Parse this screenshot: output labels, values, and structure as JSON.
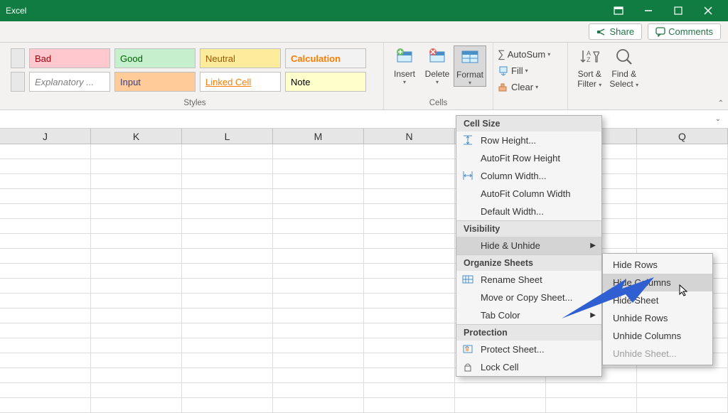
{
  "app": {
    "title": "Excel"
  },
  "actions": {
    "share": "Share",
    "comments": "Comments"
  },
  "styles": {
    "label": "Styles",
    "bad": "Bad",
    "good": "Good",
    "neutral": "Neutral",
    "calc": "Calculation",
    "expl": "Explanatory ...",
    "input": "Input",
    "linked": "Linked Cell",
    "note": "Note"
  },
  "cells": {
    "label": "Cells",
    "insert": "Insert",
    "delete": "Delete",
    "format": "Format"
  },
  "editing": {
    "autosum": "AutoSum",
    "fill": "Fill",
    "clear": "Clear",
    "sort": "Sort &",
    "filter": "Filter",
    "find": "Find &",
    "select": "Select"
  },
  "columns": [
    "J",
    "K",
    "L",
    "M",
    "N",
    "",
    "",
    "Q"
  ],
  "format_menu": {
    "cell_size": "Cell Size",
    "row_height": "Row Height...",
    "autofit_row": "AutoFit Row Height",
    "col_width": "Column Width...",
    "autofit_col": "AutoFit Column Width",
    "default_width": "Default Width...",
    "visibility": "Visibility",
    "hide_unhide": "Hide & Unhide",
    "organize": "Organize Sheets",
    "rename": "Rename Sheet",
    "move_copy": "Move or Copy Sheet...",
    "tab_color": "Tab Color",
    "protection": "Protection",
    "protect": "Protect Sheet...",
    "lock": "Lock Cell"
  },
  "submenu": {
    "hide_rows": "Hide Rows",
    "hide_cols": "Hide Columns",
    "hide_sheet": "Hide Sheet",
    "unhide_rows": "Unhide Rows",
    "unhide_cols": "Unhide Columns",
    "unhide_sheet": "Unhide Sheet..."
  }
}
